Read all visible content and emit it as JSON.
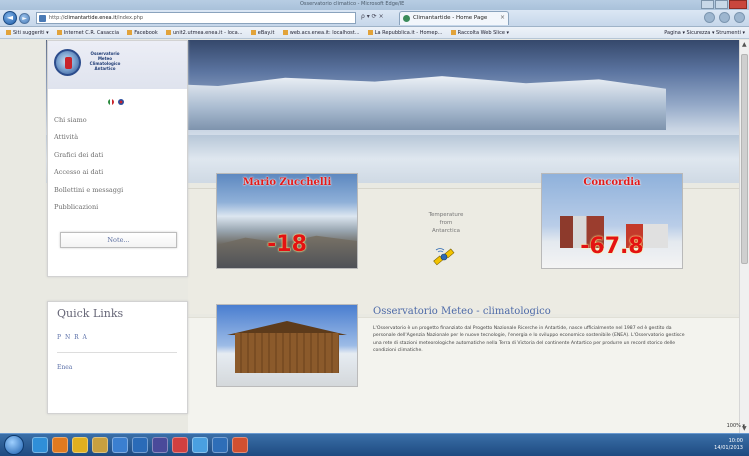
{
  "browser": {
    "window_title": "Osservatorio climatico - Microsoft Edge/IE",
    "url_prefix": "http://",
    "url_host": "climantartide.enea.it",
    "url_path": "/index.php",
    "addr_tools": "ρ ▾ ⟳ ×",
    "tab_label": "Climantartide - Home Page",
    "tab_close": "×",
    "back": "◄",
    "forward": "►",
    "favorites": [
      "Siti suggeriti ▾",
      "Internet C.R. Casaccia",
      "Facebook",
      "unit2.utmea.enea.it - loca...",
      "eBay.it",
      "web.acs.enea.it: localhost...",
      "La Repubblica.it - Homep...",
      "Raccolta Web Slice ▾"
    ],
    "commands": "Pagina ▾  Sicurezza ▾  Strumenti ▾"
  },
  "sidebar": {
    "logo_text": "Osservatorio Meteo Climatologico Antartico",
    "menu": [
      "Chi siamo",
      "Attività",
      "Grafici dei dati",
      "Accesso ai dati",
      "Bollettini e messaggi",
      "Pubblicazioni"
    ],
    "note_button": "Note..."
  },
  "stations": [
    {
      "name": "Mario Zucchelli",
      "temperature": "-18"
    },
    {
      "name": "Concordia",
      "temperature": "-67.8"
    }
  ],
  "temperature_link": {
    "line1": "Temperature",
    "line2": "from",
    "line3": "Antarctica"
  },
  "quick_links": {
    "title": "Quick Links",
    "items": [
      "P N R A",
      "Enea"
    ]
  },
  "observatory": {
    "title": "Osservatorio Meteo - climatologico",
    "text": "L'Osservatorio è un progetto finanziato dal Progetto Nazionale Ricerche in Antartide, nasce ufficialmente nel 1987 ed è gestito da personale dell'Agenzia Nazionale per le nuove tecnologie, l'energia e lo sviluppo economico sostenibile (ENEA). L'Osservatorio gestisce una rete di stazioni meteorologiche automatiche nella Terra di Victoria del continente Antartico per produrre un record storico delle condizioni climatiche."
  },
  "status": {
    "zoom": "100% ▾"
  },
  "taskbar": {
    "time": "10:00",
    "date": "14/01/2013"
  },
  "colors": {
    "accent_red": "#e21a1a",
    "link_blue": "#5a6fa8",
    "taskbar": "#1e4a80"
  }
}
